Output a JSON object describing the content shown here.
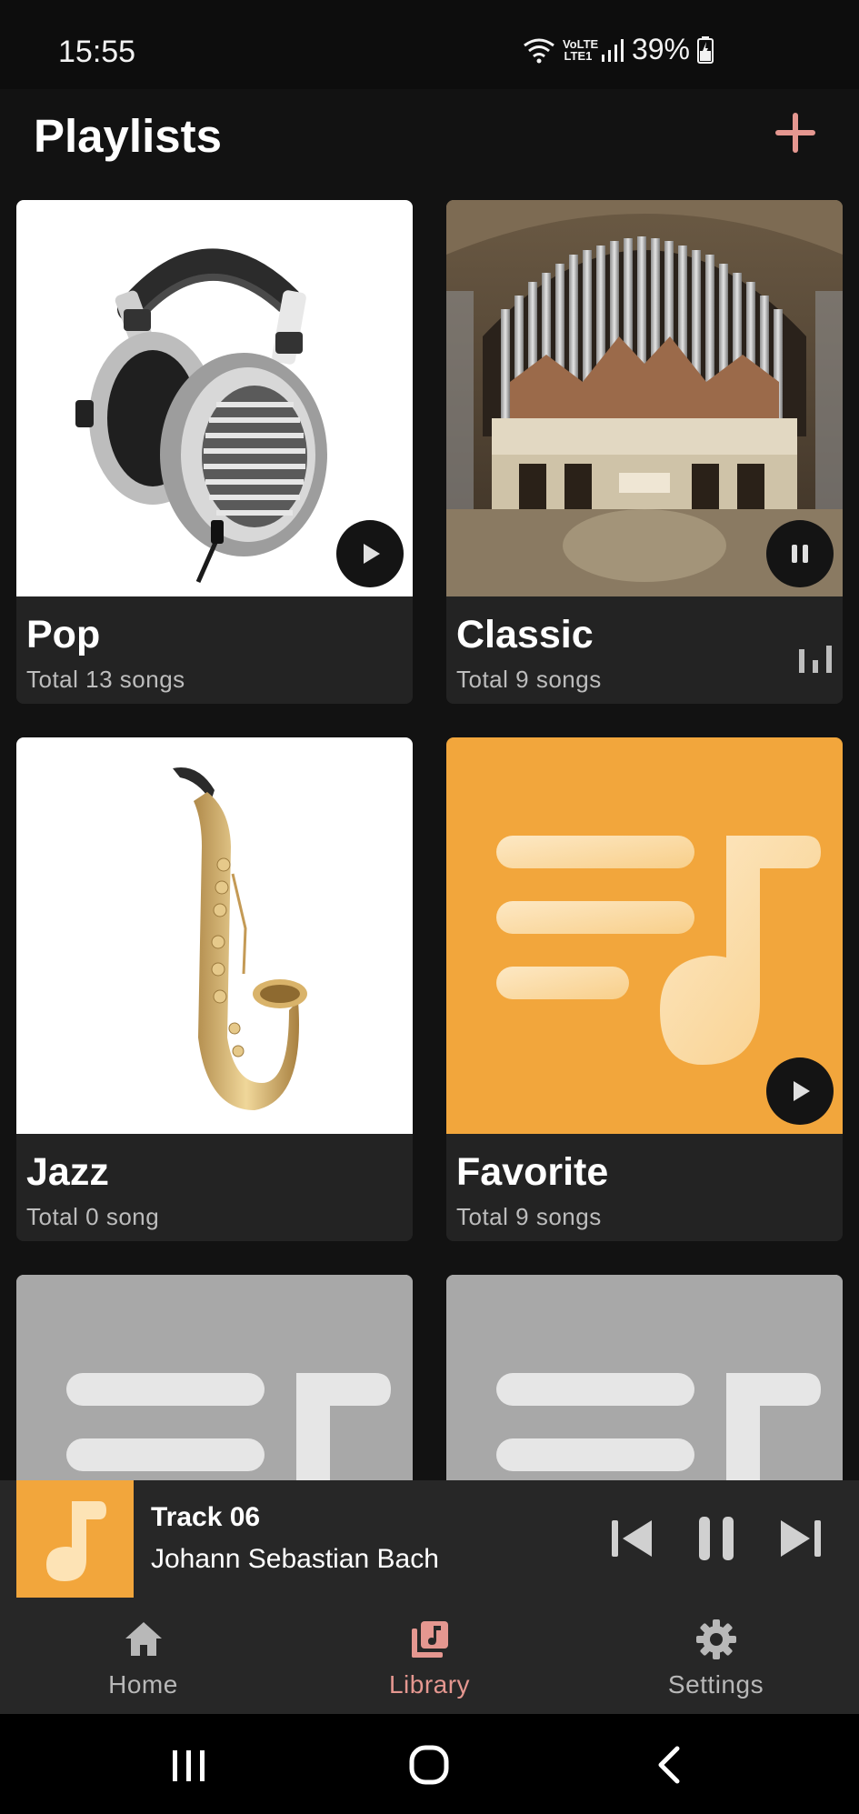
{
  "status_bar": {
    "time": "15:55",
    "network": "VoLTE LTE1",
    "battery": "39%"
  },
  "header": {
    "title": "Playlists",
    "add_icon": "plus-icon",
    "accent_color": "#e59790"
  },
  "playlists": [
    {
      "title": "Pop",
      "subtitle": "Total 13 songs",
      "art": "headphones-image",
      "state": "play"
    },
    {
      "title": "Classic",
      "subtitle": "Total 9 songs",
      "art": "pipe-organ-image",
      "state": "playing"
    },
    {
      "title": "Jazz",
      "subtitle": "Total 0 song",
      "art": "saxophone-image",
      "state": "none"
    },
    {
      "title": "Favorite",
      "subtitle": "Total 9 songs",
      "art": "playlist-placeholder",
      "state": "play"
    },
    {
      "title": "",
      "subtitle": "",
      "art": "playlist-placeholder-grey",
      "state": "none"
    },
    {
      "title": "",
      "subtitle": "",
      "art": "playlist-placeholder-grey",
      "state": "none"
    }
  ],
  "mini_player": {
    "track": "Track 06",
    "artist": "Johann Sebastian Bach",
    "art_color": "#f2a63c"
  },
  "bottom_nav": {
    "items": [
      {
        "label": "Home",
        "icon": "home-icon"
      },
      {
        "label": "Library",
        "icon": "library-icon",
        "active": true
      },
      {
        "label": "Settings",
        "icon": "gear-icon"
      }
    ]
  },
  "system_nav": {
    "icons": [
      "recent-apps-icon",
      "home-circle-icon",
      "back-icon"
    ]
  }
}
